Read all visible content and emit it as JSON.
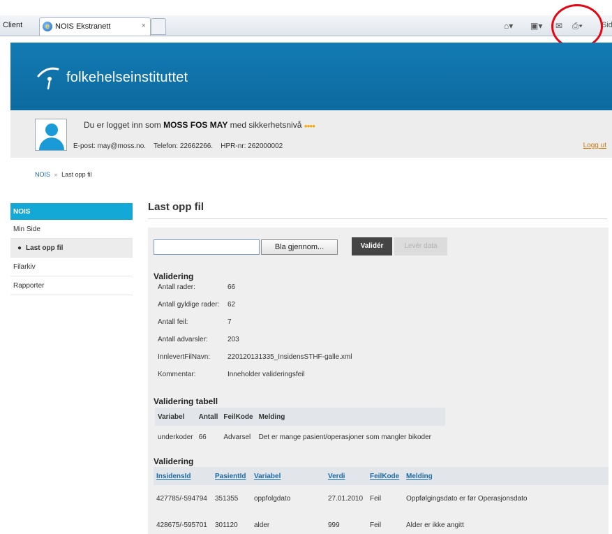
{
  "browser": {
    "tab_prev": "Client",
    "tab_title": "NOIS Ekstranett",
    "tab_close": "×",
    "cmd_more": "Sid"
  },
  "header": {
    "logo_text": "folkehelseinstituttet"
  },
  "user": {
    "logged_in_prefix": "Du er logget inn som",
    "name": "MOSS FOS MAY",
    "security_suffix": "med sikkerhetsnivå",
    "security_stars": "●●●●",
    "email_label": "E-post:",
    "email": "may@moss.no.",
    "phone_label": "Telefon:",
    "phone": "22662266.",
    "hpr_label": "HPR-nr:",
    "hpr": "262000002",
    "logout": "Logg ut"
  },
  "breadcrumb": {
    "home": "NOIS",
    "separator": "»",
    "current": "Last opp fil"
  },
  "sidebar": {
    "head": "NOIS",
    "items": [
      {
        "label": "Min Side"
      },
      {
        "label": "Last opp fil",
        "active": true
      },
      {
        "label": "Filarkiv"
      },
      {
        "label": "Rapporter"
      }
    ]
  },
  "main": {
    "title": "Last opp fil",
    "browse_label": "Bla gjennom...",
    "validate_label": "Validér",
    "deliver_label": "Levér data",
    "validation": {
      "title": "Validering",
      "rows": [
        {
          "key": "Antall rader:",
          "value": "66"
        },
        {
          "key": "Antall gyldige rader:",
          "value": "62"
        },
        {
          "key": "Antall feil:",
          "value": "7"
        },
        {
          "key": "Antall advarsler:",
          "value": "203"
        },
        {
          "key": "InnlevertFilNavn:",
          "value": "220120131335_InsidensSTHF-galle.xml"
        },
        {
          "key": "Kommentar:",
          "value": "Inneholder valideringsfeil"
        }
      ]
    },
    "table1": {
      "title": "Validering tabell",
      "headers": [
        "Variabel",
        "Antall",
        "FeilKode",
        "Melding"
      ],
      "rows": [
        [
          "underkoder",
          "66",
          "Advarsel",
          "Det er mange pasient/operasjoner som mangler bikoder"
        ]
      ]
    },
    "table2": {
      "title": "Validering",
      "headers": [
        "InsidensId",
        "PasientId",
        "Variabel",
        "Verdi",
        "FeilKode",
        "Melding"
      ],
      "rows": [
        [
          "427785/-594794",
          "351355",
          "oppfolgdato",
          "27.01.2010",
          "Feil",
          "Oppfølgingsdato er før Operasjonsdato"
        ],
        [
          "428675/-595701",
          "301120",
          "alder",
          "999",
          "Feil",
          "Alder er ikke angitt"
        ]
      ]
    }
  }
}
